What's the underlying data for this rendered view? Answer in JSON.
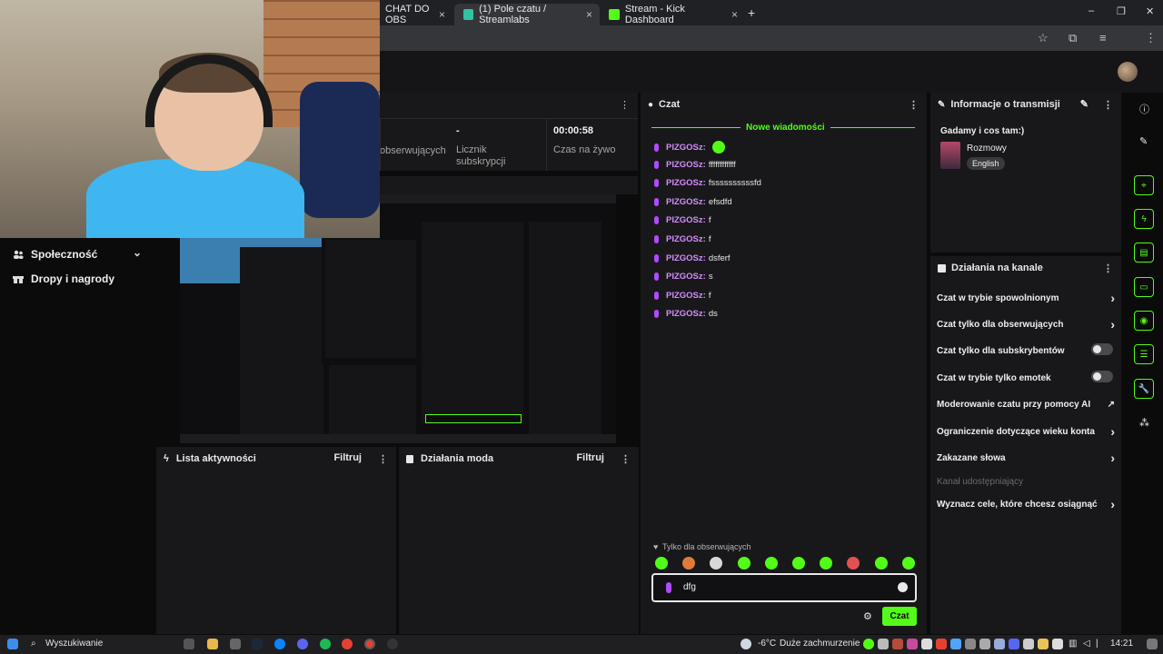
{
  "browser": {
    "tabs": [
      {
        "label": "CHAT DO OBS",
        "close": "×"
      },
      {
        "label": "(1) Pole czatu / Streamlabs",
        "close": "×"
      },
      {
        "label": "Stream - Kick Dashboard",
        "close": "×"
      }
    ],
    "new_tab": "+",
    "window_controls": [
      "–",
      "❐",
      "✕"
    ]
  },
  "stats": [
    {
      "value": "",
      "label": "obserwujących"
    },
    {
      "value": "-",
      "label": "Licznik subskrypcji"
    },
    {
      "value": "00:00:58",
      "label": "Czas na żywo"
    }
  ],
  "sidebar": {
    "items": [
      {
        "label": "Społeczność",
        "icon": "users-icon"
      },
      {
        "label": "Dropy i nagrody",
        "icon": "gift-icon"
      }
    ]
  },
  "chat": {
    "title": "Czat",
    "new_messages": "Nowe wiadomości",
    "messages": [
      {
        "user": "PIZGOSz:",
        "text": ""
      },
      {
        "user": "PIZGOSz:",
        "text": "ffffffffffff"
      },
      {
        "user": "PIZGOSz:",
        "text": "fssssssssssfd"
      },
      {
        "user": "PIZGOSz:",
        "text": "efsdfd"
      },
      {
        "user": "PIZGOSz:",
        "text": "f"
      },
      {
        "user": "PIZGOSz:",
        "text": "f"
      },
      {
        "user": "PIZGOSz:",
        "text": "dsferf"
      },
      {
        "user": "PIZGOSz:",
        "text": "s"
      },
      {
        "user": "PIZGOSz:",
        "text": "f"
      },
      {
        "user": "PIZGOSz:",
        "text": "ds"
      }
    ],
    "followers_only": "Tylko dla obserwujących",
    "input_value": "dfg",
    "send_label": "Czat"
  },
  "stream_info": {
    "title": "Informacje o transmisji",
    "stream_title": "Gadamy i cos tam:)",
    "category": "Rozmowy",
    "language": "English"
  },
  "channel_actions": {
    "title": "Działania na kanale",
    "items": [
      {
        "label": "Czat w trybie spowolnionym",
        "control": "chevron"
      },
      {
        "label": "Czat tylko dla obserwujących",
        "control": "chevron"
      },
      {
        "label": "Czat tylko dla subskrybentów",
        "control": "toggle"
      },
      {
        "label": "Czat w trybie tylko emotek",
        "control": "toggle"
      },
      {
        "label": "Moderowanie czatu przy pomocy AI",
        "control": "external"
      },
      {
        "label": "Ograniczenie dotyczące wieku konta",
        "control": "chevron"
      },
      {
        "label": "Zakazane słowa",
        "control": "chevron"
      },
      {
        "label": "Kanał udostępniający",
        "control": "none"
      },
      {
        "label": "Wyznacz cele, które chcesz osiągnąć",
        "control": "chevron"
      }
    ]
  },
  "activity": {
    "title": "Lista aktywności",
    "filter": "Filtruj"
  },
  "mod_actions": {
    "title": "Działania moda",
    "filter": "Filtruj"
  },
  "taskbar": {
    "search": "Wyszukiwanie",
    "weather_temp": "-6°C",
    "weather_text": "Duże zachmurzenie",
    "time": "14:21"
  },
  "colors": {
    "accent": "#53fc18",
    "username": "#d58cff",
    "panel": "#18181a"
  }
}
